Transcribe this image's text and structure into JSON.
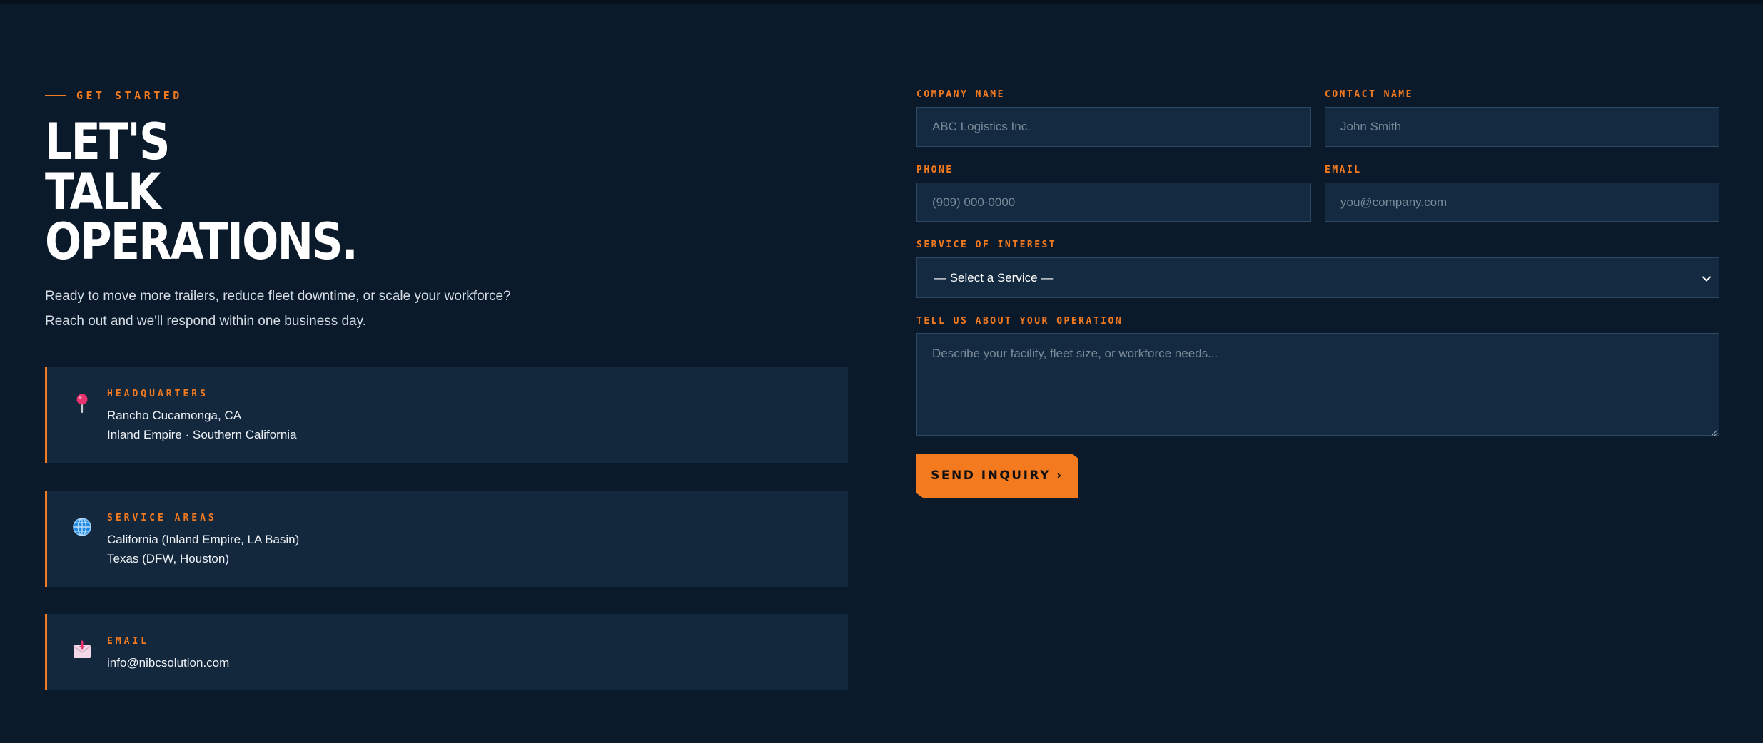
{
  "intro_section": {
    "eyebrow": "GET STARTED",
    "headline_lines": [
      "LET'S",
      "TALK",
      "OPERATIONS."
    ],
    "description_lines": [
      "Ready to move more trailers, reduce fleet downtime, or scale your workforce?",
      "Reach out and we'll respond within one business day."
    ]
  },
  "info_cards": [
    {
      "icon": "map-pin-icon",
      "label": "HEADQUARTERS",
      "lines": [
        "Rancho Cucamonga, CA",
        "Inland Empire · Southern California"
      ]
    },
    {
      "icon": "globe-icon",
      "label": "SERVICE AREAS",
      "lines": [
        "California (Inland Empire, LA Basin)",
        "Texas (DFW, Houston)"
      ]
    },
    {
      "icon": "envelope-icon",
      "label": "EMAIL",
      "lines": [
        "info@nibcsolution.com"
      ]
    }
  ],
  "form": {
    "company_name": {
      "label": "COMPANY NAME",
      "placeholder": "ABC Logistics Inc."
    },
    "contact_name": {
      "label": "CONTACT NAME",
      "placeholder": "John Smith"
    },
    "phone": {
      "label": "PHONE",
      "placeholder": "(909) 000-0000"
    },
    "email": {
      "label": "EMAIL",
      "placeholder": "you@company.com"
    },
    "service": {
      "label": "SERVICE OF INTEREST",
      "selected": "— Select a Service —"
    },
    "message": {
      "label": "TELL US ABOUT YOUR OPERATION",
      "placeholder": "Describe your facility, fleet size, or workforce needs..."
    },
    "submit_label": "SEND INQUIRY ›"
  },
  "colors": {
    "background": "#0b1a2a",
    "card": "#13283d",
    "accent": "#f47a1f",
    "input_border": "#2c4863"
  }
}
